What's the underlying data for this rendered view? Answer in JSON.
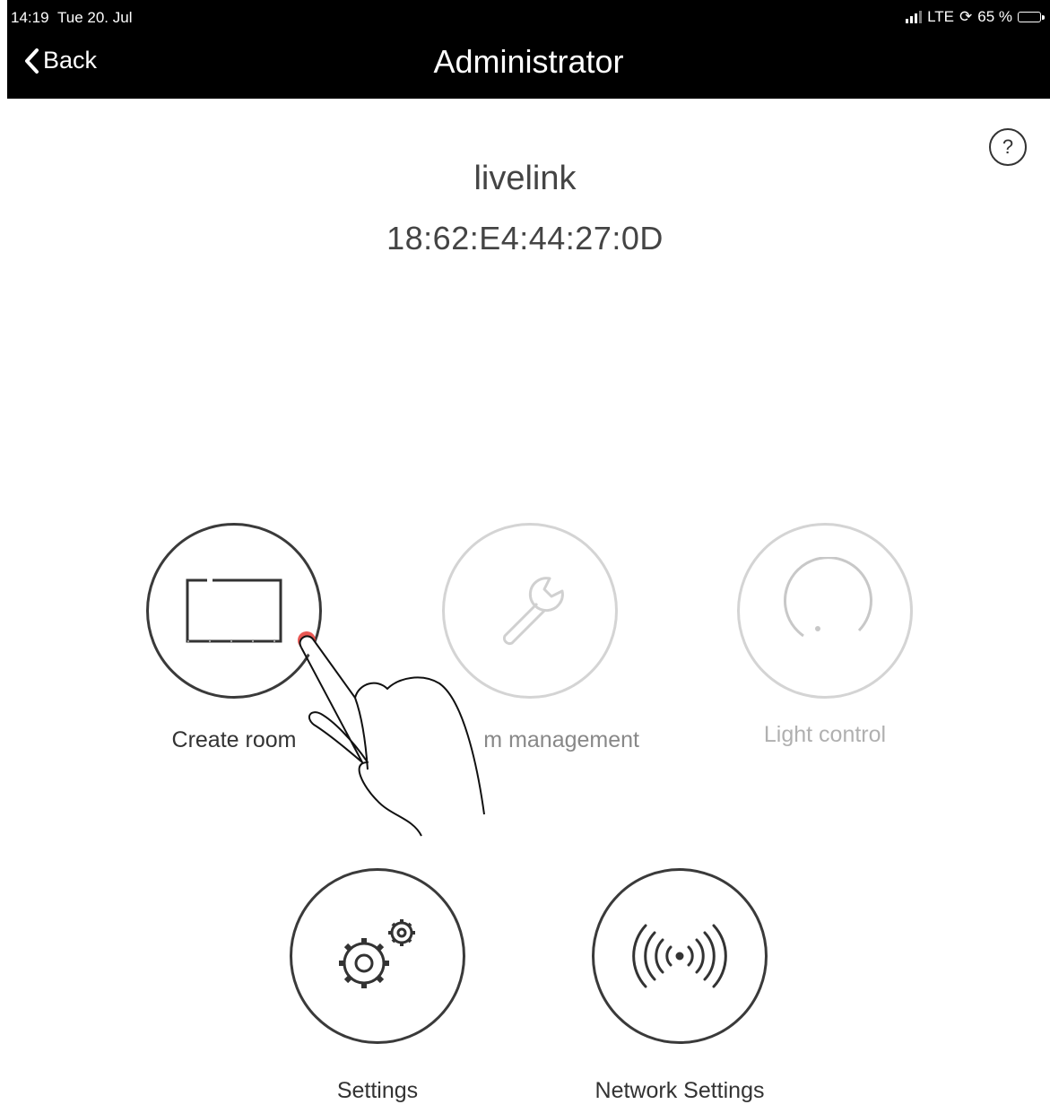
{
  "status_bar": {
    "time": "14:19",
    "date": "Tue 20. Jul",
    "network": "LTE",
    "battery": "65 %",
    "battery_level": 0.65
  },
  "nav": {
    "back_label": "Back",
    "title": "Administrator"
  },
  "device": {
    "name": "livelink",
    "mac": "18:62:E4:44:27:0D"
  },
  "tiles": [
    {
      "label": "Create room",
      "enabled": true,
      "icon": "room-icon"
    },
    {
      "label": "m management",
      "enabled": false,
      "icon": "wrench-icon"
    },
    {
      "label": "Light control",
      "enabled": false,
      "icon": "dimmer-icon"
    },
    {
      "label": "Settings",
      "enabled": true,
      "icon": "gears-icon"
    },
    {
      "label": "Network Settings",
      "enabled": true,
      "icon": "wireless-icon"
    }
  ],
  "colors": {
    "bar": "#000000",
    "active": "#3a3a3a",
    "disabled": "#d4d4d4",
    "touch": "#e53935"
  }
}
